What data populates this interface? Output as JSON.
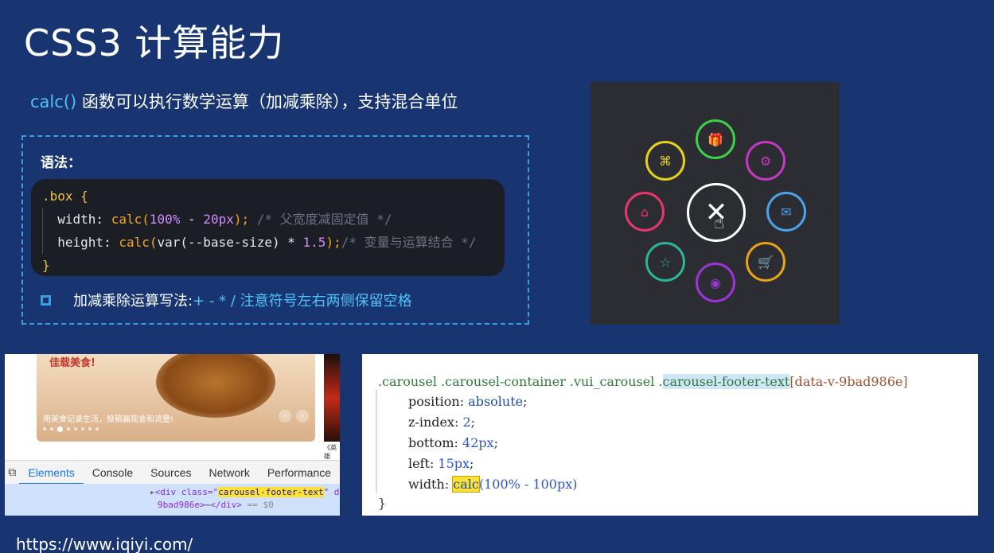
{
  "slide": {
    "title": "CSS3 计算能力",
    "subtitle_calc": "calc()",
    "subtitle_rest": " 函数可以执行数学运算（加减乘除），支持混合单位",
    "syntax_label": "语法：",
    "code": {
      "selector": ".box {",
      "line1_prop": "width: ",
      "line1_fn": "calc(",
      "line1_num1": "100%",
      "line1_mid": " - ",
      "line1_num2": "20px",
      "line1_end": ");",
      "line1_comment": " /* 父宽度减固定值 */",
      "line2_prop": "height: ",
      "line2_fn": "calc(",
      "line2_var": "var(--base-size)",
      "line2_mid": " * ",
      "line2_num": "1.5",
      "line2_end": ");",
      "line2_comment": "/* 变量与运算结合 */",
      "close": "}"
    },
    "rule_text": "加减乘除运算写法: ",
    "rule_highlight": "+ - * /  注意符号左右两侧保留空格",
    "url": "https://www.iqiyi.com/"
  },
  "menu_demo": {
    "center_icon": "close-icon",
    "items": [
      {
        "icon": "gift-icon",
        "color": "#3fcf4a",
        "glyph": "🎁"
      },
      {
        "icon": "command-icon",
        "color": "#e6d11a",
        "glyph": "⌘"
      },
      {
        "icon": "settings-icon",
        "color": "#c339c3",
        "glyph": "⚙"
      },
      {
        "icon": "home-icon",
        "color": "#e8376b",
        "glyph": "⌂"
      },
      {
        "icon": "mail-icon",
        "color": "#4aa3e8",
        "glyph": "✉"
      },
      {
        "icon": "star-icon",
        "color": "#2bb59a",
        "glyph": "☆"
      },
      {
        "icon": "cart-icon",
        "color": "#e8a21a",
        "glyph": "🛒"
      },
      {
        "icon": "chat-icon",
        "color": "#9b35d6",
        "glyph": "◉"
      }
    ]
  },
  "browser": {
    "banner_badge": "佳载美食!",
    "banner_caption": "用美食记录生活，投稿赢现金和流量!",
    "side_caption": "《英雄",
    "tabs": [
      "Elements",
      "Console",
      "Sources",
      "Network",
      "Performance"
    ],
    "active_tab": "Elements",
    "dom_line1_tag": "<div class=\"",
    "dom_line1_val": "carousel-footer-text",
    "dom_line1_rest": "\" d",
    "dom_line2": "9bad986e>",
    "dom_line2_end": "</div>",
    "dom_line2_eq": " == $0"
  },
  "css_rule": {
    "sel1": ".carousel .carousel-container .vui_carousel .",
    "sel_hl": "carousel-footer-text",
    "sel_attr": "[data-v-9bad986e]",
    "p1": "position",
    "v1": "absolute",
    "p2": "z-index",
    "v2": "2",
    "p3": "bottom",
    "v3": "42px",
    "p4": "left",
    "v4": "15px",
    "p5": "width",
    "v5_fn": "calc",
    "v5_args": "(100% - 100px)",
    "close": "}"
  }
}
